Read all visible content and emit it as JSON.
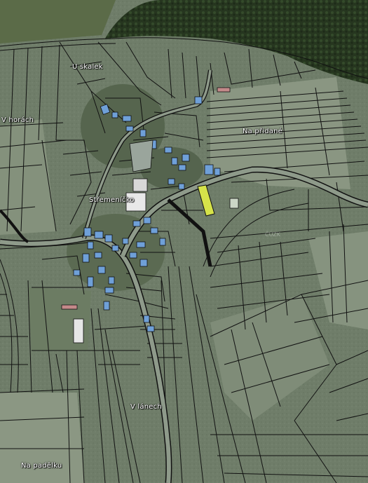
{
  "map": {
    "labels": {
      "u_skalek": "U skalek",
      "v_horach": "V horách",
      "na_pridane": "Na přidané",
      "stremenicko": "Střemeníčko",
      "v_lanech": "V lánech",
      "na_padelku": "Na padělku"
    },
    "watermark": "ČÚZK",
    "colors": {
      "forest": "#2b3d26",
      "field": "#7b8a74",
      "parcel_line": "#111111",
      "building": "#6fa0d8",
      "highlight_parcel": "#d6e34a",
      "road": "#8e9a8a"
    }
  }
}
